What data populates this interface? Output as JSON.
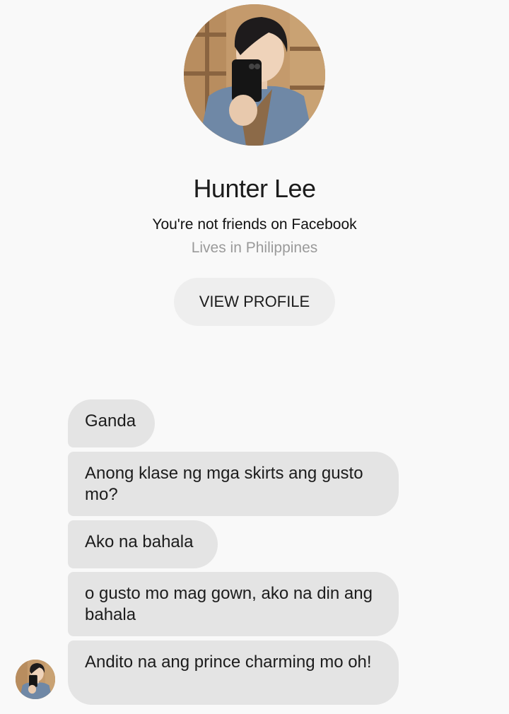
{
  "profile": {
    "name": "Hunter Lee",
    "friend_status": "You're not friends on Facebook",
    "location": "Lives in Philippines",
    "view_profile_label": "VIEW PROFILE"
  },
  "messages": [
    {
      "text": "Ganda"
    },
    {
      "text": "Anong klase ng mga skirts ang gusto mo?"
    },
    {
      "text": "Ako na bahala"
    },
    {
      "text": "o gusto mo mag gown, ako na din ang bahala"
    },
    {
      "text": "Andito na ang prince charming mo oh!"
    }
  ],
  "colors": {
    "background": "#f9f9f9",
    "bubble": "#e4e4e4",
    "button": "#eeeeee",
    "muted_text": "#9a9a9a"
  }
}
